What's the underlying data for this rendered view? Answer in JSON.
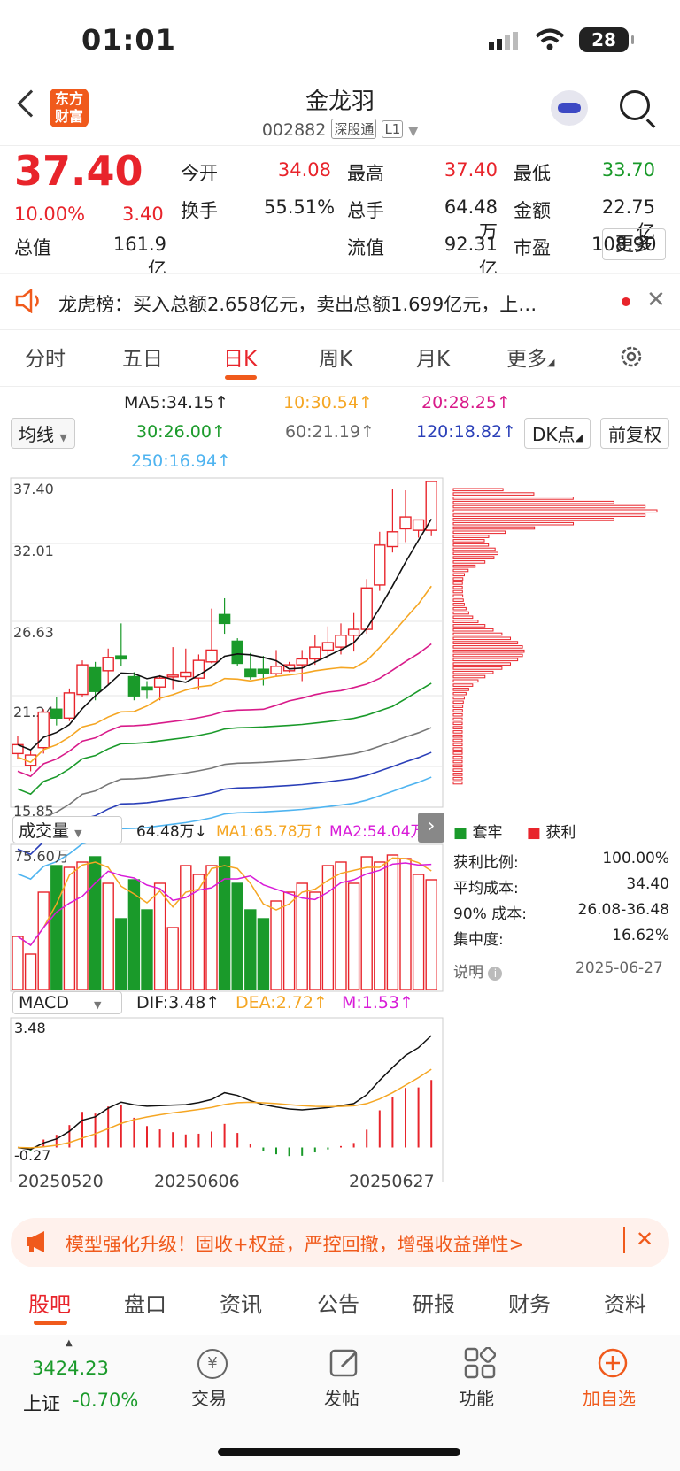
{
  "status": {
    "time": "01:01",
    "battery": "28"
  },
  "header": {
    "logo": "东方\n财富",
    "title": "金龙羽",
    "code": "002882",
    "tag1": "深股通",
    "tag2": "L1"
  },
  "quote": {
    "price": "37.40",
    "pct": "10.00%",
    "chg": "3.40",
    "items": [
      {
        "k": "今开",
        "v": "34.08",
        "c": "red"
      },
      {
        "k": "最高",
        "v": "37.40",
        "c": "red"
      },
      {
        "k": "最低",
        "v": "33.70",
        "c": "green"
      },
      {
        "k": "换手",
        "v": "55.51%",
        "c": ""
      },
      {
        "k": "总手",
        "v": "64.48万",
        "c": ""
      },
      {
        "k": "金额",
        "v": "22.75亿",
        "c": ""
      },
      {
        "k": "总值",
        "v": "161.9亿",
        "c": ""
      },
      {
        "k": "流值",
        "v": "92.31亿",
        "c": ""
      },
      {
        "k": "市盈",
        "v": "108.90",
        "c": ""
      }
    ],
    "more": "更多"
  },
  "notice": {
    "text": "龙虎榜：买入总额2.658亿元，卖出总额1.699亿元，上…"
  },
  "tabs": [
    "分时",
    "五日",
    "日K",
    "周K",
    "月K",
    "更多"
  ],
  "ma": {
    "selector": "均线",
    "ma5": "MA5:34.15↑",
    "ma10": "10:30.54↑",
    "ma20": "20:28.25↑",
    "ma30": "30:26.00↑",
    "ma60": "60:21.19↑",
    "ma120": "120:18.82↑",
    "ma250": "250:16.94↑",
    "dk": "DK点",
    "fq": "前复权"
  },
  "chart_data": {
    "type": "candlestick",
    "y_labels": [
      "37.40",
      "32.01",
      "26.63",
      "21.24",
      "15.85"
    ],
    "ylim": [
      15.85,
      37.4
    ],
    "dates": [
      "20250520",
      "20250606",
      "20250627"
    ],
    "candles": [
      [
        19.0,
        20.2,
        18.6,
        19.6
      ],
      [
        18.2,
        19.2,
        17.8,
        18.9
      ],
      [
        19.4,
        22.0,
        19.0,
        21.8
      ],
      [
        22.0,
        22.8,
        20.9,
        21.4
      ],
      [
        21.4,
        23.4,
        21.2,
        23.1
      ],
      [
        23.0,
        25.3,
        22.8,
        25.0
      ],
      [
        24.8,
        25.2,
        22.6,
        23.2
      ],
      [
        24.6,
        26.1,
        23.6,
        25.5
      ],
      [
        25.6,
        27.8,
        24.9,
        25.4
      ],
      [
        24.2,
        24.5,
        22.6,
        22.9
      ],
      [
        23.5,
        23.9,
        22.7,
        23.3
      ],
      [
        23.5,
        24.3,
        22.6,
        24.1
      ],
      [
        24.2,
        26.2,
        23.3,
        24.3
      ],
      [
        24.2,
        26.1,
        24.0,
        24.5
      ],
      [
        24.1,
        25.7,
        23.3,
        25.3
      ],
      [
        25.2,
        28.8,
        25.1,
        26.0
      ],
      [
        28.4,
        29.5,
        27.1,
        27.8
      ],
      [
        26.6,
        26.8,
        24.9,
        25.1
      ],
      [
        24.7,
        25.8,
        24.0,
        24.2
      ],
      [
        24.7,
        25.6,
        23.6,
        24.4
      ],
      [
        24.4,
        26.0,
        24.2,
        24.9
      ],
      [
        24.6,
        25.2,
        24.5,
        25.0
      ],
      [
        25.0,
        26.0,
        23.9,
        25.4
      ],
      [
        25.4,
        27.0,
        25.0,
        26.2
      ],
      [
        26.0,
        27.6,
        25.4,
        26.5
      ],
      [
        26.2,
        27.8,
        25.7,
        27.0
      ],
      [
        27.0,
        28.5,
        25.9,
        27.4
      ],
      [
        27.4,
        30.8,
        27.1,
        30.2
      ],
      [
        30.4,
        34.0,
        30.0,
        33.1
      ],
      [
        33.0,
        36.9,
        32.6,
        34.0
      ],
      [
        34.2,
        36.8,
        33.3,
        35.0
      ],
      [
        34.1,
        34.8,
        33.6,
        34.8
      ],
      [
        34.1,
        37.4,
        33.7,
        37.4
      ]
    ],
    "volume": {
      "label": "成交量",
      "value": "64.48万↓",
      "ma1": "MA1:65.78万↑",
      "ma2": "MA2:54.04万↑",
      "top": "75.60万"
    },
    "volumes": [
      30,
      20,
      55,
      70,
      69,
      72,
      75,
      60,
      40,
      62,
      45,
      60,
      35,
      70,
      65,
      70,
      75,
      60,
      45,
      40,
      50,
      55,
      60,
      55,
      70,
      72,
      60,
      75,
      72,
      76,
      74,
      65,
      62
    ],
    "macd": {
      "label": "MACD",
      "dif": "DIF:3.48↑",
      "dea": "DEA:2.72↑",
      "m": "M:1.53↑",
      "top": "3.48",
      "bottom": "-0.27"
    }
  },
  "chips": {
    "legend1": "套牢",
    "legend2": "获利",
    "rows": [
      {
        "k": "获利比例:",
        "v": "100.00%"
      },
      {
        "k": "平均成本:",
        "v": "34.40"
      },
      {
        "k": "90% 成本:",
        "v": "26.08-36.48"
      },
      {
        "k": "集中度:",
        "v": "16.62%"
      }
    ],
    "note": "说明",
    "date": "2025-06-27"
  },
  "ad": {
    "text": "模型强化升级！固收+权益，严控回撤，增强收益弹性>"
  },
  "bottom_tabs": [
    "股吧",
    "盘口",
    "资讯",
    "公告",
    "研报",
    "财务",
    "资料"
  ],
  "footer": {
    "index": "3424.23",
    "index_name": "上证",
    "index_chg": "-0.70%",
    "trade": "交易",
    "post": "发帖",
    "func": "功能",
    "add": "加自选"
  },
  "colors": {
    "up": "#e8242b",
    "down": "#1a9a2a",
    "accent": "#f05a1c"
  }
}
